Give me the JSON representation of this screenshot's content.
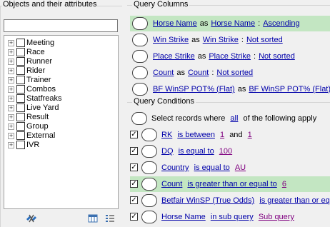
{
  "left_panel": {
    "title": "Objects and their attributes",
    "search_value": "",
    "tree_items": [
      {
        "label": "Meeting"
      },
      {
        "label": "Race"
      },
      {
        "label": "Runner"
      },
      {
        "label": "Rider"
      },
      {
        "label": "Trainer"
      },
      {
        "label": "Combos"
      },
      {
        "label": "Statfreaks"
      },
      {
        "label": "Live Yard"
      },
      {
        "label": "Result"
      },
      {
        "label": "Group"
      },
      {
        "label": "External"
      },
      {
        "label": "IVR"
      }
    ]
  },
  "query_columns": {
    "title": "Query Columns",
    "as_word": "as",
    "rows": [
      {
        "field": "Horse Name",
        "alias": "Horse Name",
        "sort": "Ascending",
        "highlighted": true
      },
      {
        "field": "Win Strike",
        "alias": "Win Strike",
        "sort": "Not sorted",
        "highlighted": false
      },
      {
        "field": "Place Strike",
        "alias": "Place Strike",
        "sort": "Not sorted",
        "highlighted": false
      },
      {
        "field": "Count",
        "alias": "Count",
        "sort": "Not sorted",
        "highlighted": false
      },
      {
        "field": "BF WinSP POT% (Flat)",
        "alias": "BF WinSP POT% (Flat)",
        "sort": "",
        "highlighted": false
      }
    ]
  },
  "query_conditions": {
    "title": "Query Conditions",
    "header": {
      "prefix": "Select records where",
      "quantifier": "all",
      "suffix": "of the following apply"
    },
    "rows": [
      {
        "field": "RK",
        "operator": "is between",
        "value": "1",
        "joiner": "and",
        "value2": "1",
        "checked": true,
        "highlighted": false
      },
      {
        "field": "DQ",
        "operator": "is equal to",
        "value": "100",
        "joiner": "",
        "value2": "",
        "checked": true,
        "highlighted": false
      },
      {
        "field": "Country",
        "operator": "is equal to",
        "value": "AU",
        "joiner": "",
        "value2": "",
        "checked": true,
        "highlighted": false
      },
      {
        "field": "Count",
        "operator": "is greater than or equal to",
        "value": "6",
        "joiner": "",
        "value2": "",
        "checked": true,
        "highlighted": true
      },
      {
        "field": "Betfair WinSP (True Odds)",
        "operator": "is greater than or equal to",
        "value": "",
        "joiner": "",
        "value2": "",
        "checked": true,
        "highlighted": false
      },
      {
        "field": "Horse Name",
        "operator": "in sub query",
        "value": "Sub query",
        "joiner": "",
        "value2": "",
        "checked": true,
        "highlighted": false
      }
    ]
  },
  "toolbar": {
    "icons": [
      "remove-link-icon",
      "columns-icon",
      "list-icon"
    ]
  },
  "colors": {
    "highlight": "#c3e6c2",
    "link": "#0000aa",
    "value_link": "#800080"
  }
}
